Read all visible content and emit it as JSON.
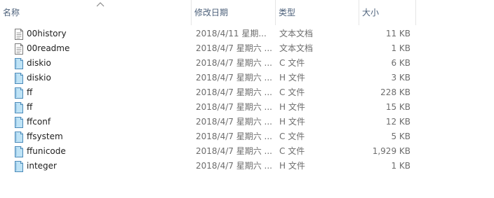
{
  "columns": {
    "name": "名称",
    "modified": "修改日期",
    "type": "类型",
    "size": "大小"
  },
  "sort": {
    "column": "name",
    "direction": "ascending",
    "icon": "sort-up-chevron-icon"
  },
  "files": [
    {
      "name": "00history",
      "modified": "2018/4/11 星期...",
      "type": "文本文档",
      "size": "11 KB",
      "icon": "text-document-icon"
    },
    {
      "name": "00readme",
      "modified": "2018/4/7 星期六 ...",
      "type": "文本文档",
      "size": "1 KB",
      "icon": "text-document-icon"
    },
    {
      "name": "diskio",
      "modified": "2018/4/7 星期六 ...",
      "type": "C 文件",
      "size": "6 KB",
      "icon": "source-file-icon"
    },
    {
      "name": "diskio",
      "modified": "2018/4/7 星期六 ...",
      "type": "H 文件",
      "size": "3 KB",
      "icon": "source-file-icon"
    },
    {
      "name": "ff",
      "modified": "2018/4/7 星期六 ...",
      "type": "C 文件",
      "size": "228 KB",
      "icon": "source-file-icon"
    },
    {
      "name": "ff",
      "modified": "2018/4/7 星期六 ...",
      "type": "H 文件",
      "size": "15 KB",
      "icon": "source-file-icon"
    },
    {
      "name": "ffconf",
      "modified": "2018/4/7 星期六 ...",
      "type": "H 文件",
      "size": "12 KB",
      "icon": "source-file-icon"
    },
    {
      "name": "ffsystem",
      "modified": "2018/4/7 星期六 ...",
      "type": "C 文件",
      "size": "5 KB",
      "icon": "source-file-icon"
    },
    {
      "name": "ffunicode",
      "modified": "2018/4/7 星期六 ...",
      "type": "C 文件",
      "size": "1,929 KB",
      "icon": "source-file-icon"
    },
    {
      "name": "integer",
      "modified": "2018/4/7 星期六 ...",
      "type": "H 文件",
      "size": "1 KB",
      "icon": "source-file-icon"
    }
  ],
  "colors": {
    "header_text": "#4c607a",
    "name_text": "#1e1e1e",
    "detail_text": "#6d6d6d",
    "divider": "#e5e5e5",
    "source_icon_fill": "#bfe3f6",
    "source_icon_stroke": "#4a89b8"
  }
}
